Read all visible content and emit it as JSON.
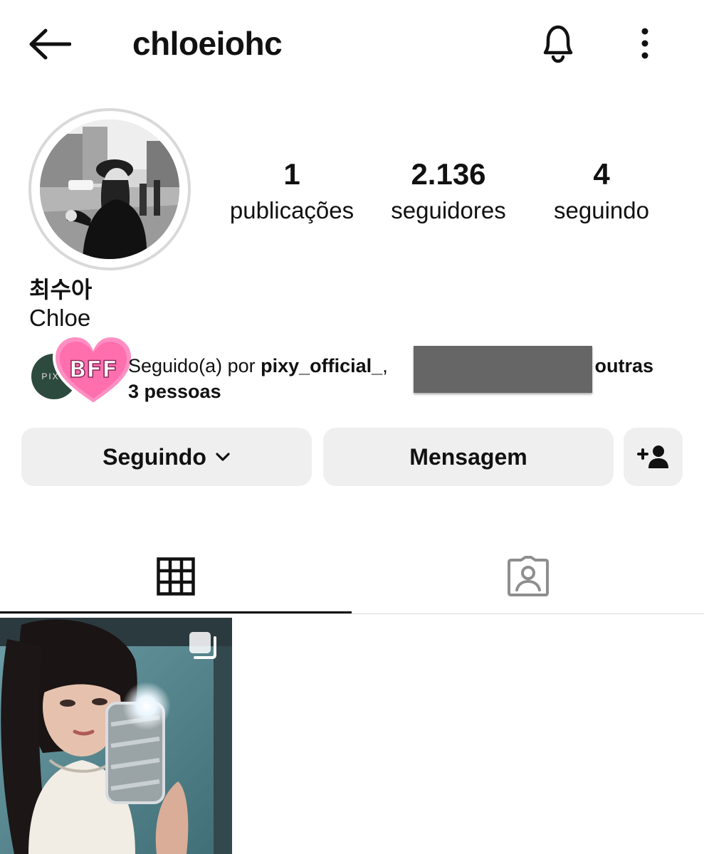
{
  "header": {
    "username": "chloeiohc",
    "icons": {
      "back": "arrow-left-icon",
      "notifications": "bell-icon",
      "more": "more-vertical-icon"
    }
  },
  "profile": {
    "stats": [
      {
        "value": "1",
        "label": "publicações"
      },
      {
        "value": "2.136",
        "label": "seguidores"
      },
      {
        "value": "4",
        "label": "seguindo"
      }
    ],
    "display_name": "최수아",
    "bio_name": "Chloe"
  },
  "followed_by": {
    "mutual_avatar_text": "PIXY",
    "sticker_text": "BFF",
    "prefix": "Seguido(a) por ",
    "account": "pixy_official_",
    "separator": ",",
    "suffix": "e outras",
    "line2": "3 pessoas"
  },
  "actions": {
    "following_label": "Seguindo",
    "message_label": "Mensagem"
  },
  "tabs": [
    {
      "name": "posts-grid",
      "icon": "grid-icon",
      "active": true
    },
    {
      "name": "tagged",
      "icon": "tagged-person-icon",
      "active": false
    }
  ],
  "colors": {
    "button_bg": "#efefef",
    "text": "#111111",
    "sticker_pink": "#ff8fc2",
    "mutual_avatar_bg": "#2d4a3e"
  }
}
